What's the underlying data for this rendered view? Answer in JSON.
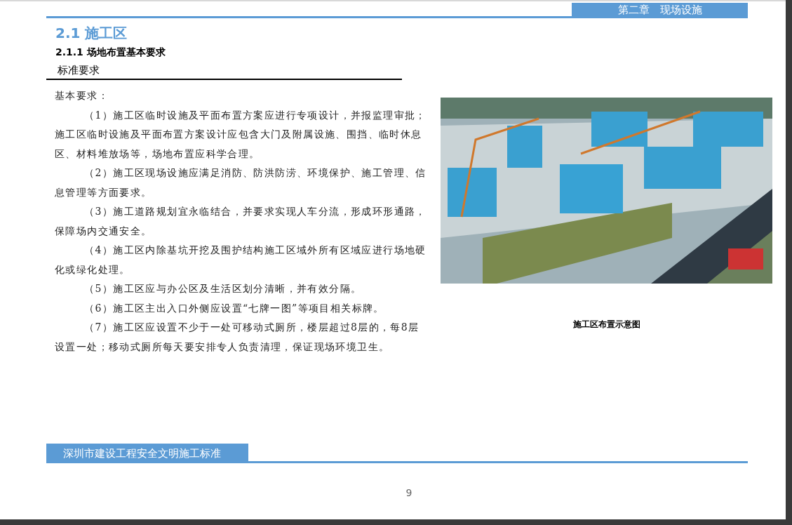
{
  "header": {
    "chapter": "第二章　现场设施"
  },
  "section": {
    "title": "2.1 施工区",
    "subtitle": "2.1.1 场地布置基本要求",
    "label": "标准要求"
  },
  "body": {
    "lead": "基本要求：",
    "paragraphs": [
      "（1）施工区临时设施及平面布置方案应进行专项设计，并报监理审批；施工区临时设施及平面布置方案设计应包含大门及附属设施、围挡、临时休息区、材料堆放场等，场地布置应科学合理。",
      "（2）施工区现场设施应满足消防、防洪防涝、环境保护、施工管理、信息管理等方面要求。",
      "（3）施工道路规划宜永临结合，并要求实现人车分流，形成环形通路，保障场内交通安全。",
      "（4）施工区内除基坑开挖及围护结构施工区域外所有区域应进行场地硬化或绿化处理。",
      "（5）施工区应与办公区及生活区划分清晰，并有效分隔。",
      "（6）施工区主出入口外侧应设置“七牌一图”等项目相关标牌。",
      "（7）施工区应设置不少于一处可移动式厕所，楼层超过8层的，每8层设置一处；移动式厕所每天要安排专人负责清理，保证现场环境卫生。"
    ]
  },
  "figure": {
    "kind": "picture",
    "caption": "施工区布置示意图"
  },
  "footer": {
    "title": "深圳市建设工程安全文明施工标准",
    "page_number": "9"
  }
}
